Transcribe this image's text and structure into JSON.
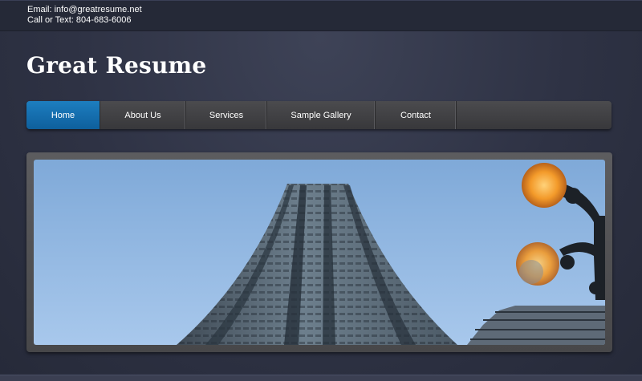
{
  "header": {
    "email_line": "Email: info@greatresume.net",
    "phone_line": "Call or Text: 804-683-6006"
  },
  "site": {
    "title": "Great Resume"
  },
  "nav": {
    "items": [
      {
        "label": "Home",
        "active": true
      },
      {
        "label": "About Us",
        "active": false
      },
      {
        "label": "Services",
        "active": false
      },
      {
        "label": "Sample Gallery",
        "active": false
      },
      {
        "label": "Contact",
        "active": false
      }
    ]
  },
  "colors": {
    "accent": "#1577b8",
    "background": "#2e3244",
    "nav_background": "#414144",
    "sky": "#8fb6e0"
  }
}
